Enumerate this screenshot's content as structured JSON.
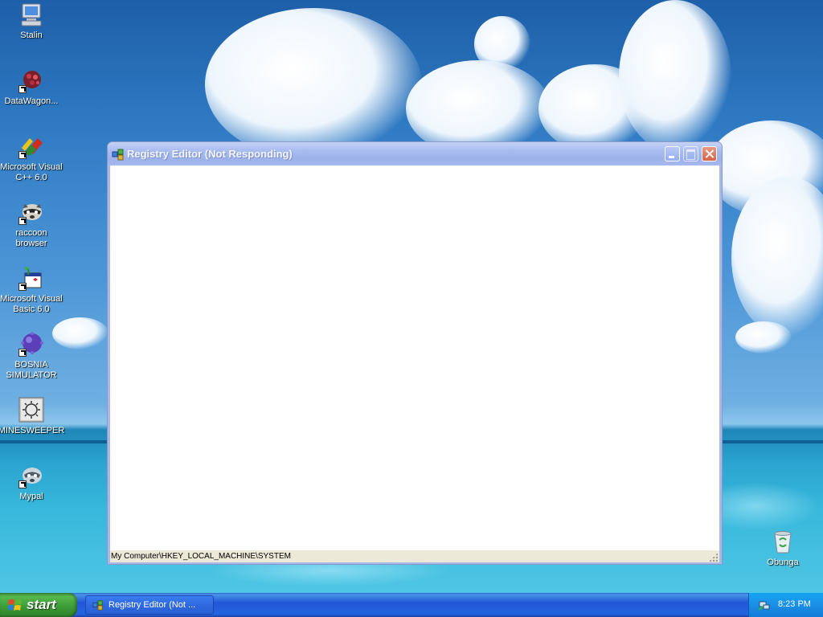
{
  "desktop": {
    "icons": [
      {
        "label": "Stalin",
        "icon": "my-computer-icon"
      },
      {
        "label": "DataWagon...",
        "icon": "datawagon-icon"
      },
      {
        "label": "Microsoft Visual C++ 6.0",
        "icon": "visual-cpp-icon"
      },
      {
        "label": "raccoon browser",
        "icon": "raccoon-icon"
      },
      {
        "label": "Microsoft Visual Basic 6.0",
        "icon": "visual-basic-icon"
      },
      {
        "label": "BOSNIA SIMULATOR",
        "icon": "bosnia-simulator-icon"
      },
      {
        "label": "MINESWEEPER",
        "icon": "minesweeper-icon"
      },
      {
        "label": "Mypal",
        "icon": "mypal-icon"
      },
      {
        "label": "Obunga",
        "icon": "recycle-bin-icon"
      }
    ]
  },
  "window": {
    "title": "Registry Editor (Not Responding)",
    "status_path": "My Computer\\HKEY_LOCAL_MACHINE\\SYSTEM"
  },
  "taskbar": {
    "start_label": "start",
    "task_label": "Registry Editor (Not ...",
    "clock": "8:23 PM"
  },
  "colors": {
    "title_inactive": "#9db2ea",
    "taskbar_blue": "#2157d7",
    "start_green": "#3a9a36",
    "tray_blue": "#1a8fe6"
  }
}
